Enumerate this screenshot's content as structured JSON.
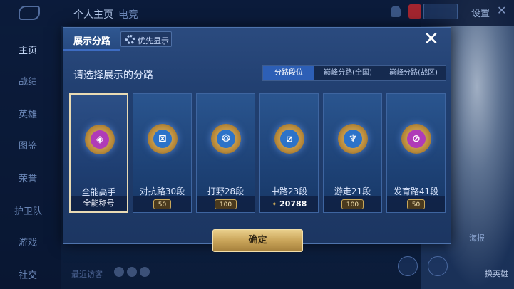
{
  "background": {
    "top_tabs": [
      "个人主页",
      "电竞 "
    ],
    "settings_label": "设置",
    "sidebar_items": [
      "主页",
      "战绩",
      "英雄",
      "图鉴",
      "荣誉",
      "护卫队",
      "游戏",
      "社交"
    ],
    "visitors_label": "最近访客",
    "hero_switch_label": "海报",
    "hero_button_label": "换英雄"
  },
  "dialog": {
    "title": "展示分路",
    "priority_label": "优先显示",
    "close_icon": "close-icon",
    "prompt": "请选择展示的分路",
    "filters": [
      {
        "label": "分路段位",
        "active": true
      },
      {
        "label": "巅峰分路(全国)",
        "active": false
      },
      {
        "label": "巅峰分路(战区)",
        "active": false
      }
    ],
    "cards": [
      {
        "label": "全能高手",
        "footer": "全能称号",
        "badge_icon": "all-round-icon",
        "badge_color": "#b03bb8",
        "selected": true
      },
      {
        "label": "对抗路30段",
        "footer": "50",
        "badge_icon": "clash-lane-icon",
        "badge_color": "#2c73c9",
        "selected": false
      },
      {
        "label": "打野28段",
        "footer": "100",
        "badge_icon": "jungle-icon",
        "badge_color": "#2c73c9",
        "selected": false
      },
      {
        "label": "中路23段",
        "footer": "20788",
        "badge_icon": "mid-lane-icon",
        "badge_color": "#2c73c9",
        "selected": false
      },
      {
        "label": "游走21段",
        "footer": "100",
        "badge_icon": "roam-icon",
        "badge_color": "#2c73c9",
        "selected": false
      },
      {
        "label": "发育路41段",
        "footer": "50",
        "badge_icon": "farm-lane-icon",
        "badge_color": "#b03bb8",
        "selected": false
      }
    ],
    "confirm_label": "确定"
  }
}
